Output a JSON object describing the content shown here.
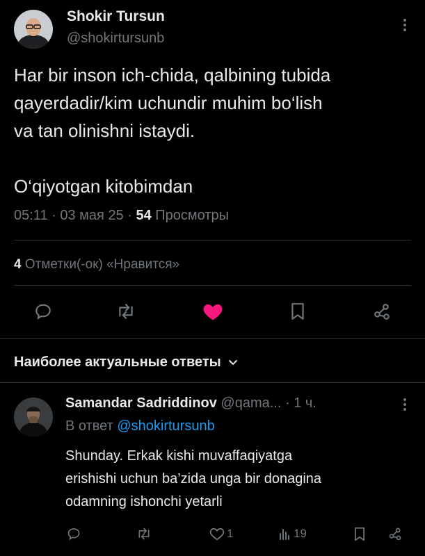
{
  "post": {
    "author_name": "Shokir Tursun",
    "author_handle": "@shokirtursunb",
    "text_line1": "Har bir inson ich-chida, qalbining tubida",
    "text_line2": "qayerdadir/kim uchundir muhim bo‘lish",
    "text_line3": "va tan olinishni istaydi.",
    "text_line4": "O‘qiyotgan kitobimdan",
    "time": "05:11",
    "dot1": "·",
    "date": "03 мая 25",
    "dot2": "·",
    "views_count": "54",
    "views_label": "Просмотры",
    "likes_count": "4",
    "likes_label": "Отметки(-ок) «Нравится»"
  },
  "replies_section": {
    "title": "Наиболее актуальные ответы"
  },
  "reply": {
    "author_name": "Samandar Sadriddinov",
    "author_handle": "@qama...",
    "time": "· 1 ч.",
    "reply_to_prefix": "В ответ",
    "reply_to_handle": "@shokirtursunb",
    "text_line1": "Shunday. Erkak kishi muvaffaqiyatga",
    "text_line2": "erishishi uchun ba’zida unga bir donagina",
    "text_line3": "odamning ishonchi yetarli",
    "like_count": "1",
    "views_count": "19"
  },
  "colors": {
    "accent": "#1d9bf0",
    "like": "#f91880",
    "text": "#e7e9ea",
    "muted": "#71767b"
  },
  "icons": [
    "more-icon",
    "reply-icon",
    "retweet-icon",
    "like-icon",
    "bookmark-icon",
    "share-icon",
    "chevron-down-icon",
    "views-icon"
  ]
}
